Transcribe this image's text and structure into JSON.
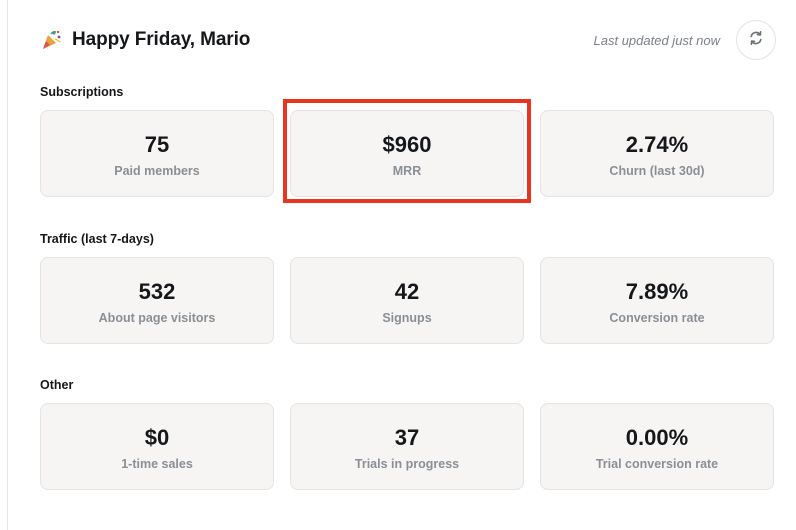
{
  "header": {
    "greeting": "Happy Friday, Mario",
    "updated": "Last updated just now"
  },
  "icons": {
    "party": "party-popper-icon",
    "refresh": "refresh-icon"
  },
  "colors": {
    "highlight": "#e8351f",
    "card_bg": "#f6f5f4"
  },
  "sections": [
    {
      "title": "Subscriptions",
      "cards": [
        {
          "value": "75",
          "label": "Paid members"
        },
        {
          "value": "$960",
          "label": "MRR"
        },
        {
          "value": "2.74%",
          "label": "Churn (last 30d)"
        }
      ]
    },
    {
      "title": "Traffic (last 7-days)",
      "cards": [
        {
          "value": "532",
          "label": "About page visitors"
        },
        {
          "value": "42",
          "label": "Signups"
        },
        {
          "value": "7.89%",
          "label": "Conversion rate"
        }
      ]
    },
    {
      "title": "Other",
      "cards": [
        {
          "value": "$0",
          "label": "1-time sales"
        },
        {
          "value": "37",
          "label": "Trials in progress"
        },
        {
          "value": "0.00%",
          "label": "Trial conversion rate"
        }
      ]
    }
  ]
}
